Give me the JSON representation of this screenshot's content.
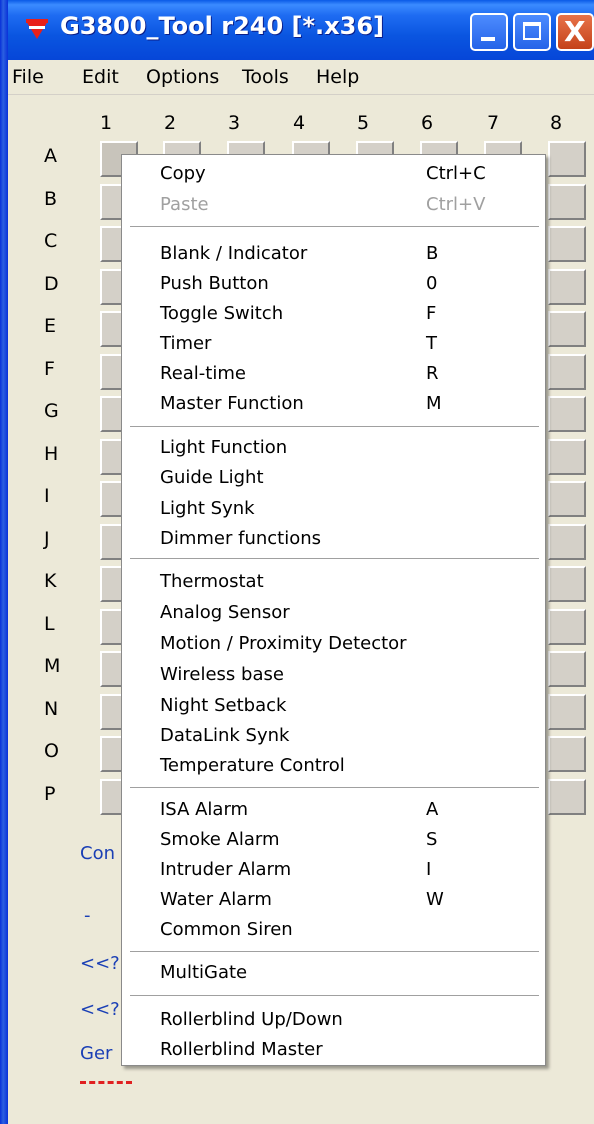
{
  "window": {
    "title": "G3800_Tool r240 [*.x36]",
    "close_glyph": "X"
  },
  "menubar": {
    "file": "File",
    "edit": "Edit",
    "options": "Options",
    "tools": "Tools",
    "help": "Help"
  },
  "grid": {
    "columns": [
      "1",
      "2",
      "3",
      "4",
      "5",
      "6",
      "7",
      "8"
    ],
    "rows": [
      "A",
      "B",
      "C",
      "D",
      "E",
      "F",
      "G",
      "H",
      "I",
      "J",
      "K",
      "L",
      "M",
      "N",
      "O",
      "P"
    ]
  },
  "background_text": {
    "con": "Con",
    "dash": "-",
    "ref1": "<<?",
    "ref2": "<<?",
    "ger": "Ger"
  },
  "context_menu": {
    "copy": {
      "label": "Copy",
      "shortcut": "Ctrl+C"
    },
    "paste": {
      "label": "Paste",
      "shortcut": "Ctrl+V"
    },
    "blank": {
      "label": "Blank / Indicator",
      "shortcut": "B"
    },
    "push": {
      "label": "Push Button",
      "shortcut": "0"
    },
    "toggle": {
      "label": "Toggle Switch",
      "shortcut": "F"
    },
    "timer": {
      "label": "Timer",
      "shortcut": "T"
    },
    "realtime": {
      "label": "Real-time",
      "shortcut": "R"
    },
    "master": {
      "label": "Master Function",
      "shortcut": "M"
    },
    "light": {
      "label": "Light Function"
    },
    "guide": {
      "label": "Guide Light"
    },
    "synk": {
      "label": "Light Synk"
    },
    "dimmer": {
      "label": "Dimmer functions"
    },
    "thermostat": {
      "label": "Thermostat"
    },
    "analog": {
      "label": "Analog Sensor"
    },
    "motion": {
      "label": "Motion / Proximity Detector"
    },
    "wireless": {
      "label": "Wireless base"
    },
    "night": {
      "label": "Night Setback"
    },
    "datalink": {
      "label": "DataLink Synk"
    },
    "temp": {
      "label": "Temperature Control"
    },
    "isa": {
      "label": "ISA Alarm",
      "shortcut": "A"
    },
    "smoke": {
      "label": "Smoke Alarm",
      "shortcut": "S"
    },
    "intruder": {
      "label": "Intruder Alarm",
      "shortcut": "I"
    },
    "water": {
      "label": "Water Alarm",
      "shortcut": "W"
    },
    "siren": {
      "label": "Common Siren"
    },
    "multigate": {
      "label": "MultiGate"
    },
    "roller_updown": {
      "label": "Rollerblind Up/Down"
    },
    "roller_master": {
      "label": "Rollerblind Master"
    }
  },
  "colors": {
    "titlebar": "#0a55e0",
    "menu_background": "#ffffff",
    "link_blue": "#1a3fb5",
    "dash_red": "#e02020"
  }
}
